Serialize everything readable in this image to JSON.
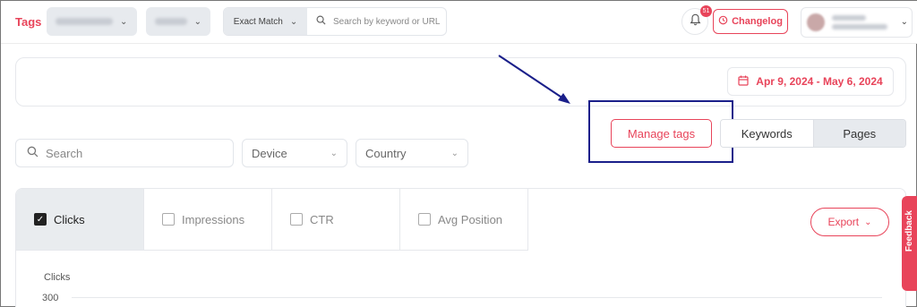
{
  "topbar": {
    "title": "Tags",
    "match_select": "Exact Match",
    "search_placeholder": "Search by keyword or URL",
    "notification_count": "51",
    "changelog_label": "Changelog"
  },
  "date_range": "Apr 9, 2024 - May 6, 2024",
  "filters": {
    "search_placeholder": "Search",
    "device_label": "Device",
    "country_label": "Country"
  },
  "manage_tags_label": "Manage tags",
  "view_toggle": {
    "keywords": "Keywords",
    "pages": "Pages",
    "selected": "Keywords"
  },
  "metrics": {
    "clicks": "Clicks",
    "impressions": "Impressions",
    "ctr": "CTR",
    "avg_position": "Avg Position",
    "checked": [
      "Clicks"
    ]
  },
  "export_label": "Export",
  "chart": {
    "y_title": "Clicks",
    "y_tick": "300"
  },
  "feedback_label": "Feedback",
  "icons": {
    "search": "magnifier-icon",
    "bell": "bell-icon",
    "changelog": "history-icon",
    "calendar": "calendar-icon",
    "chevron": "chevron-down-icon"
  },
  "colors": {
    "accent": "#e8445a",
    "highlight_box": "#1a1f8a"
  }
}
